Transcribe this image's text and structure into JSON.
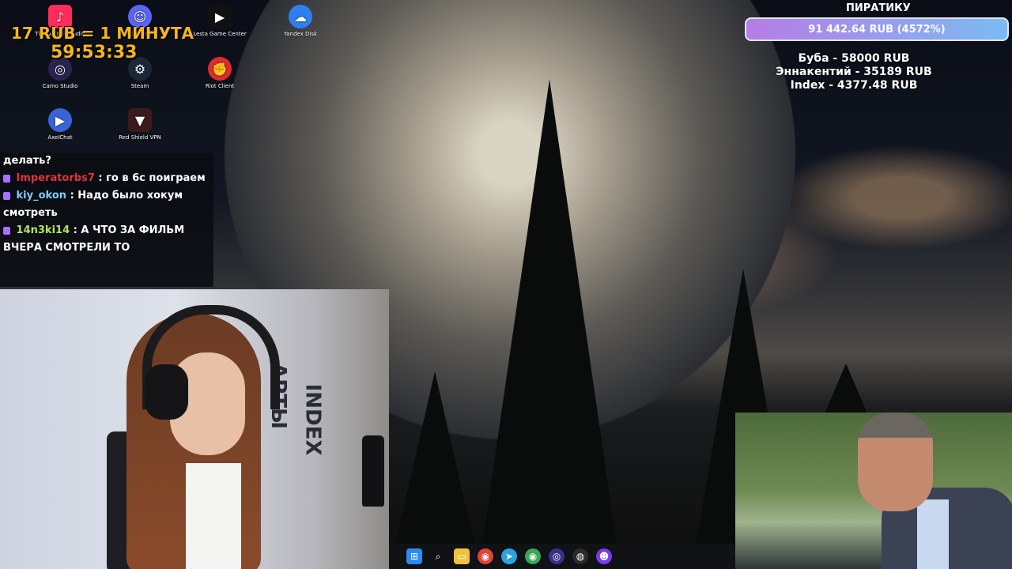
{
  "timer": {
    "rate": "17 RUB = 1 МИНУТА",
    "remaining": "59:53:33"
  },
  "desktop_icons": [
    {
      "label": "TikTok LIVE Studio",
      "icon": "tiktok-icon"
    },
    {
      "label": "Discord",
      "icon": "discord-icon"
    },
    {
      "label": "Lesta Game Center",
      "icon": "lesta-icon"
    },
    {
      "label": "Yandex Disk",
      "icon": "yandex-disk-icon"
    },
    {
      "label": "Camo Studio",
      "icon": "camo-icon"
    },
    {
      "label": "Steam",
      "icon": "steam-icon"
    },
    {
      "label": "Riot Client",
      "icon": "riot-icon"
    },
    {
      "label": "AxelChat",
      "icon": "axelchat-icon"
    },
    {
      "label": "Red Shield VPN",
      "icon": "vpn-icon"
    }
  ],
  "chat": {
    "messages": [
      {
        "user": "",
        "text": "делать?",
        "user_color": "#ffffff"
      },
      {
        "user": "Imperatorbs7",
        "text": ": го в 6с поиграем",
        "user_color": "#e0323c"
      },
      {
        "user": "kiy_okon",
        "text": ": Надо было хокум смотреть",
        "user_color": "#7ecbf2"
      },
      {
        "user": "14n3ki14",
        "text": ": А ЧТО ЗА ФИЛЬМ ВЧЕРА СМОТРЕЛИ ТО",
        "user_color": "#b6e35a"
      }
    ]
  },
  "donation_goal": {
    "title": "ПИРАТИКУ",
    "amount": "91 442.64 RUB (4572%)",
    "top_donors": [
      "Буба - 58000 RUB",
      "Эннакентий - 35189 RUB",
      "Index - 4377.48 RUB"
    ]
  },
  "taskbar": {
    "icons": [
      "windows-start-icon",
      "search-icon",
      "file-explorer-icon",
      "chrome-icon",
      "telegram-icon",
      "chrome-alt-icon",
      "camo-icon",
      "obs-icon",
      "twitch-icon"
    ]
  }
}
